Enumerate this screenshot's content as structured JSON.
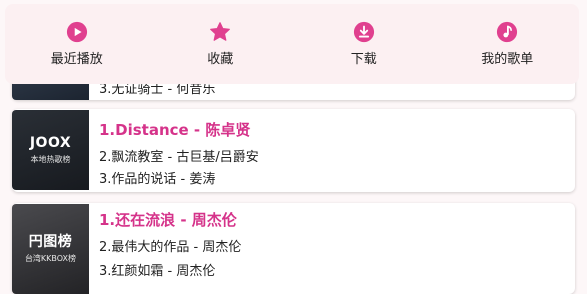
{
  "nav": {
    "items": [
      {
        "label": "最近播放",
        "icon": "play-circle-icon"
      },
      {
        "label": "收藏",
        "icon": "star-icon"
      },
      {
        "label": "下载",
        "icon": "download-icon"
      },
      {
        "label": "我的歌单",
        "icon": "music-note-icon"
      }
    ]
  },
  "colors": {
    "accent": "#d5338a",
    "icon": "#e0408f",
    "nav_bg": "#fcf0f2",
    "page_bg": "#fdf7f8"
  },
  "charts": [
    {
      "partial_line3": "3.无证骑士 - 何昔乐"
    },
    {
      "thumb_brand": "JOOX",
      "thumb_sub": "本地热歌榜",
      "line1": "1.Distance - 陈卓贤",
      "line2": "2.飘流教室 - 古巨基/吕爵安",
      "line3": "3.作品的说话 - 姜涛"
    },
    {
      "thumb_brand": "円图榜",
      "thumb_sub": "台湾KKBOX榜",
      "line1": "1.还在流浪 - 周杰伦",
      "line2": "2.最伟大的作品 - 周杰伦",
      "line3": "3.红颜如霜 - 周杰伦"
    }
  ]
}
